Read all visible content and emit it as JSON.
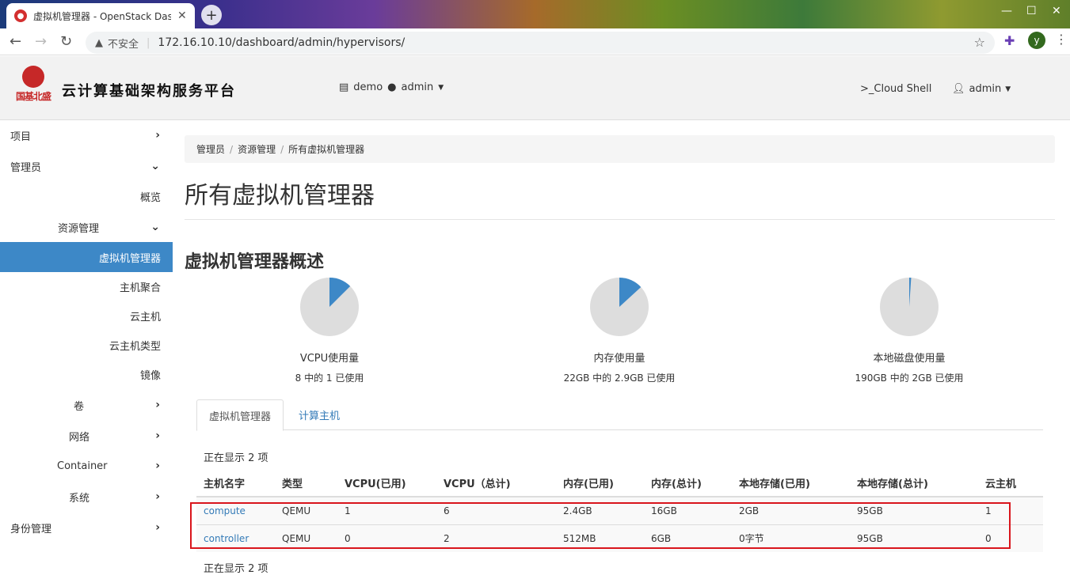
{
  "browser": {
    "tab_title": "虚拟机管理器 - OpenStack Dashboard",
    "new_tab": "+",
    "security_label": "不安全",
    "url": "172.16.10.10/dashboard/admin/hypervisors/",
    "profile_initial": "y"
  },
  "header": {
    "logo_text": "国基北盛",
    "platform_title": "云计算基础架构服务平台",
    "project": "demo",
    "region": "admin",
    "cloud_shell": ">_Cloud Shell",
    "user": "admin"
  },
  "sidebar": {
    "items": [
      {
        "label": "项目"
      },
      {
        "label": "管理员"
      },
      {
        "label": "概览"
      },
      {
        "label": "资源管理"
      },
      {
        "label": "虚拟机管理器"
      },
      {
        "label": "主机聚合"
      },
      {
        "label": "云主机"
      },
      {
        "label": "云主机类型"
      },
      {
        "label": "镜像"
      },
      {
        "label": "卷"
      },
      {
        "label": "网络"
      },
      {
        "label": "Container"
      },
      {
        "label": "系统"
      },
      {
        "label": "身份管理"
      }
    ]
  },
  "breadcrumb": [
    "管理员",
    "资源管理",
    "所有虚拟机管理器"
  ],
  "page_title": "所有虚拟机管理器",
  "summary": {
    "title": "虚拟机管理器概述",
    "pies": [
      {
        "label": "VCPU使用量",
        "detail": "8 中的 1 已使用",
        "used": 1,
        "total": 8
      },
      {
        "label": "内存使用量",
        "detail": "22GB 中的 2.9GB 已使用",
        "used": 2.9,
        "total": 22
      },
      {
        "label": "本地磁盘使用量",
        "detail": "190GB 中的 2GB 已使用",
        "used": 2,
        "total": 190
      }
    ]
  },
  "tabs": {
    "hypervisors": "虚拟机管理器",
    "compute_hosts": "计算主机"
  },
  "table": {
    "count_top": "正在显示 2 项",
    "count_bottom": "正在显示 2 项",
    "headers": [
      "主机名字",
      "类型",
      "VCPU(已用)",
      "VCPU（总计)",
      "内存(已用)",
      "内存(总计)",
      "本地存储(已用)",
      "本地存储(总计)",
      "云主机"
    ],
    "rows": [
      [
        "compute",
        "QEMU",
        "1",
        "6",
        "2.4GB",
        "16GB",
        "2GB",
        "95GB",
        "1"
      ],
      [
        "controller",
        "QEMU",
        "0",
        "2",
        "512MB",
        "6GB",
        "0字节",
        "95GB",
        "0"
      ]
    ]
  },
  "colors": {
    "accent": "#3d88c7",
    "pie_used": "#3d88c7",
    "pie_free": "#dddddd",
    "highlight": "#d9151c"
  }
}
